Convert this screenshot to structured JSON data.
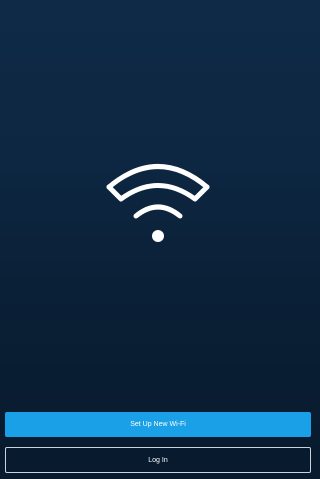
{
  "logo": {
    "icon": "wifi-icon",
    "color": "#ffffff"
  },
  "actions": {
    "setup_label": "Set Up New Wi-Fi",
    "login_label": "Log In"
  },
  "colors": {
    "background_top": "#0f2a47",
    "background_bottom": "#081a2d",
    "primary_button": "#1aa0e6",
    "secondary_border": "#c9d3dd"
  }
}
